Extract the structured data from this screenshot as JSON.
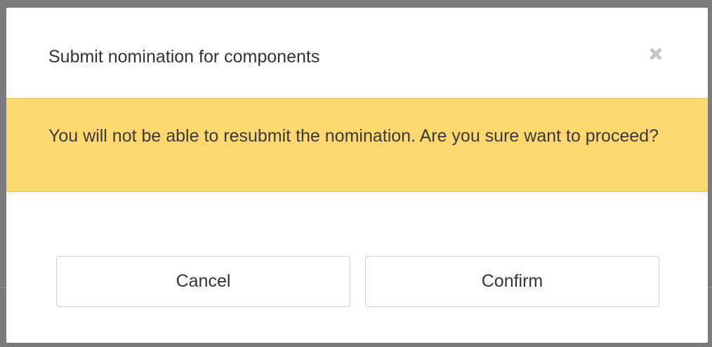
{
  "dialog": {
    "title": "Submit nomination for components",
    "close_icon": "close-icon",
    "warning_message": "You will not be able to resubmit the nomination. Are you sure want to proceed?",
    "cancel_label": "Cancel",
    "confirm_label": "Confirm"
  },
  "colors": {
    "overlay": "#7a7a7a",
    "dialog_background": "#ffffff",
    "warning_background": "#fdd86f",
    "warning_border": "#f3c24b",
    "button_border": "#cccccc",
    "text": "#333333"
  }
}
